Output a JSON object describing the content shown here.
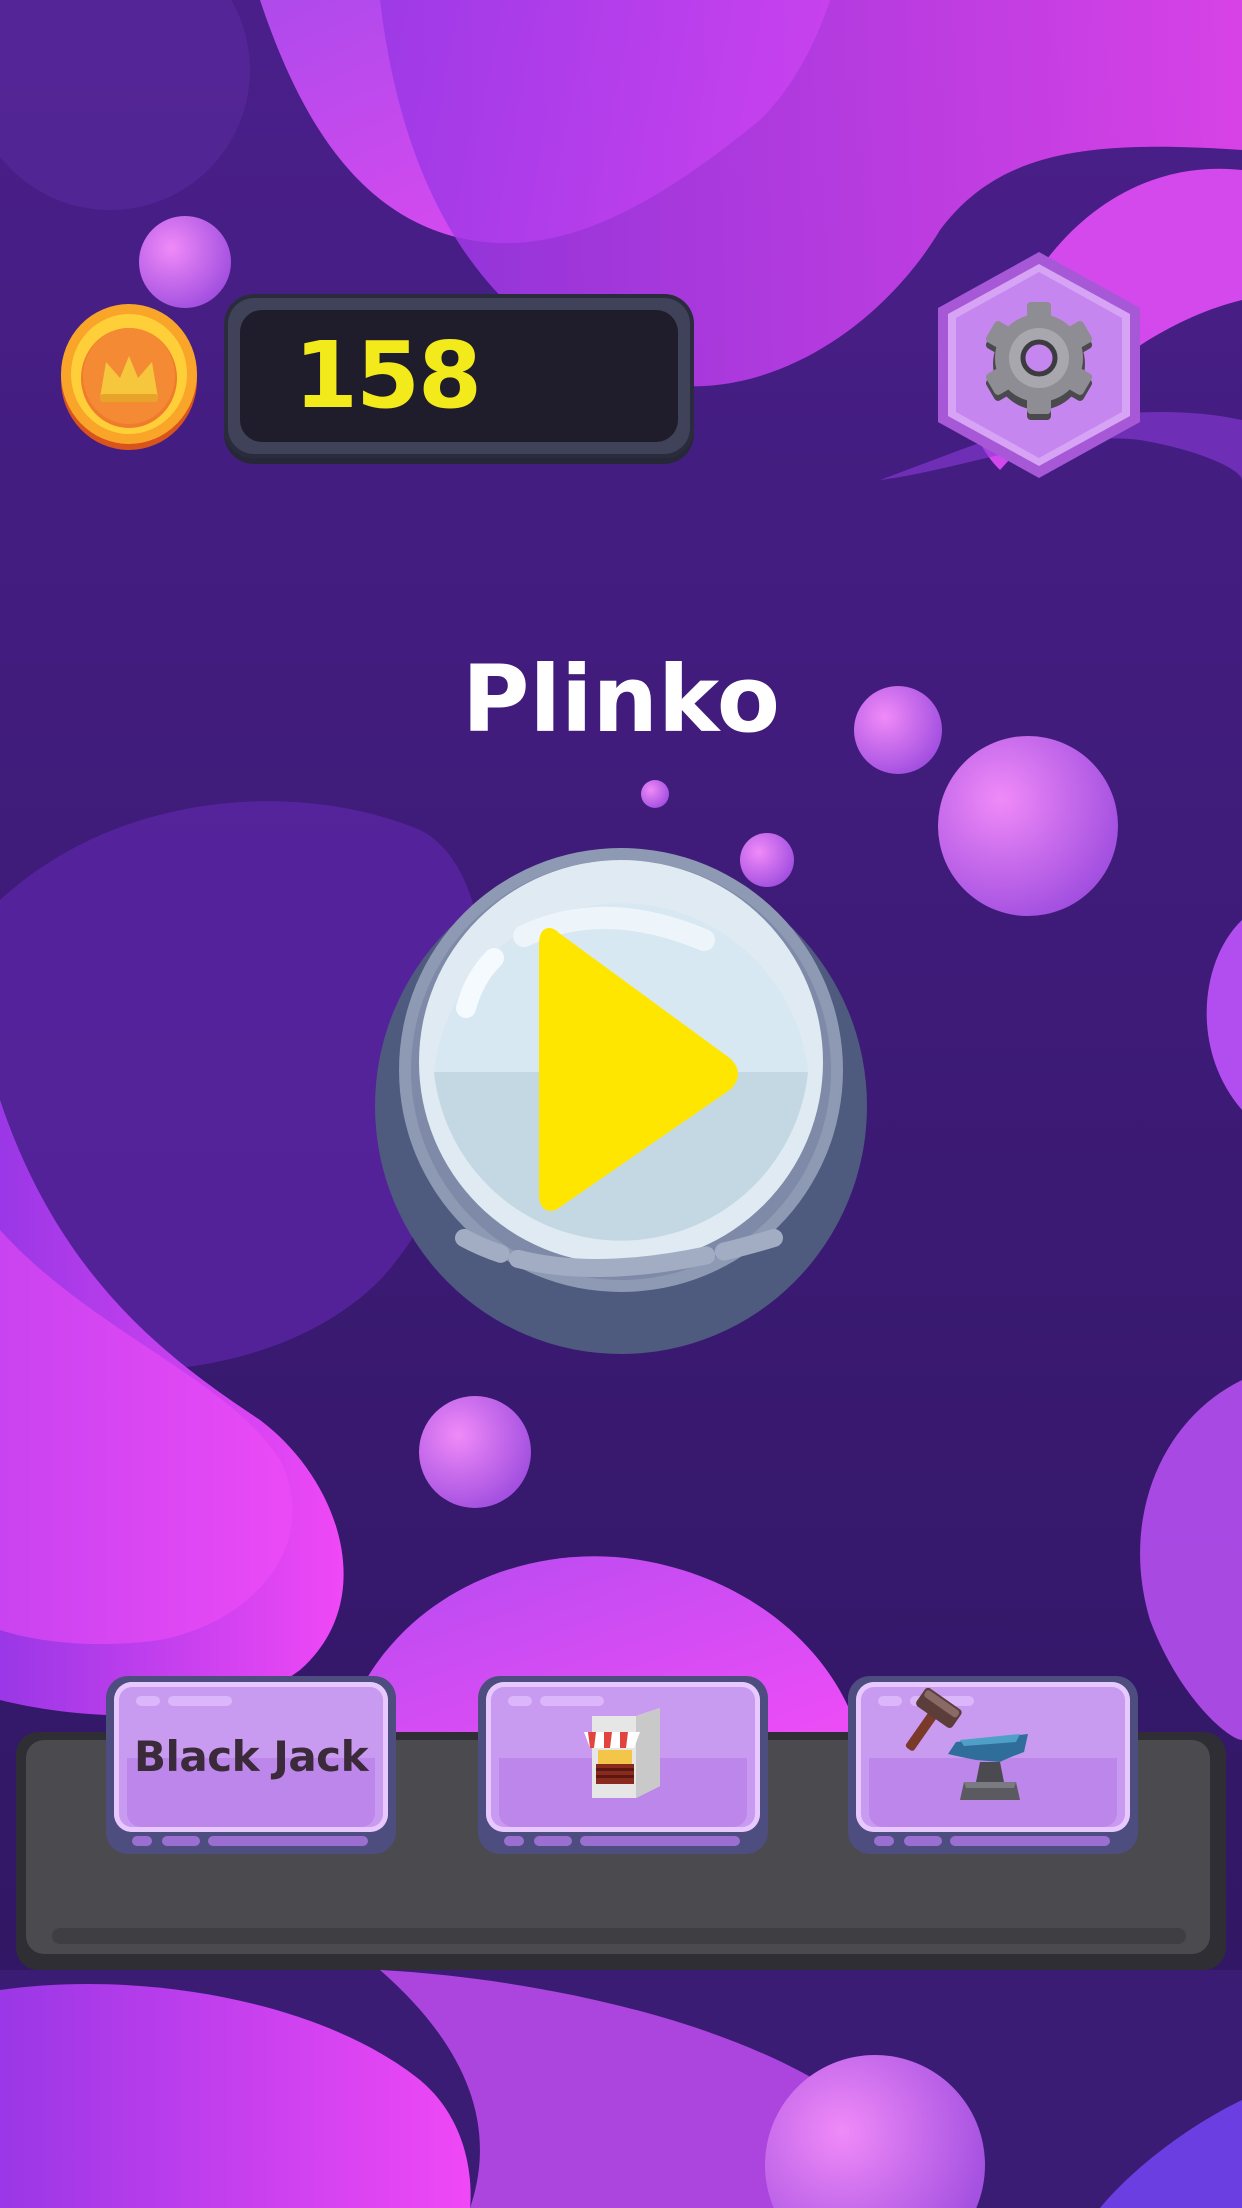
{
  "hud": {
    "coin_icon": "crown-coin-icon",
    "score": "158"
  },
  "game": {
    "title": "Plinko"
  },
  "settings": {
    "icon": "gear-icon"
  },
  "play": {
    "icon": "play-icon"
  },
  "menu": {
    "blackjack_label": "Black Jack",
    "shop_icon": "shop-stall-icon",
    "forge_icon": "anvil-hammer-icon"
  },
  "colors": {
    "background": "#3a1a6e",
    "accent_magenta": "#e040fb",
    "score_yellow": "#f3ea1c",
    "play_yellow": "#ffe600",
    "button_lilac": "#c89af0"
  }
}
